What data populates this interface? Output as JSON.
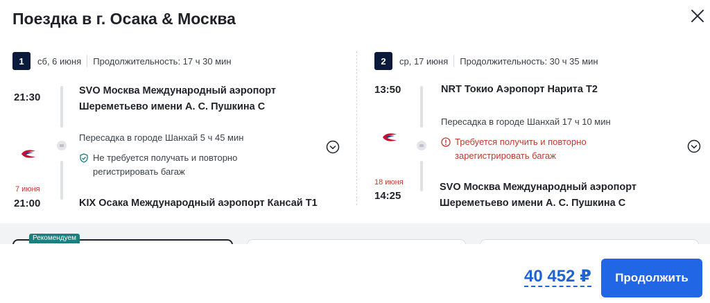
{
  "header": {
    "title": "Поездка в г. Осака & Москва"
  },
  "legs": [
    {
      "number": "1",
      "date": "сб, 6 июня",
      "duration": "Продолжительность: 17 ч 30 мин",
      "depart_time": "21:30",
      "depart_airport": "SVO Москва Международный аэропорт Шереметьево имени А. С. Пушкина C",
      "transfer": "Пересадка в городе Шанхай   5 ч 45 мин",
      "baggage_note": "Не требуется получать и повторно регистрировать багаж",
      "baggage_status": "ok",
      "arrive_date": "7 июня",
      "arrive_time": "21:00",
      "arrive_airport": "KIX Осака Международный аэропорт Кансай T1"
    },
    {
      "number": "2",
      "date": "ср, 17 июня",
      "duration": "Продолжительность: 30 ч 35 мин",
      "depart_time": "13:50",
      "depart_airport": "NRT Токио Аэропорт Нарита T2",
      "transfer": "Пересадка в городе Шанхай   17 ч 10 мин",
      "baggage_note": "Требуется получить и повторно зарегистрировать багаж",
      "baggage_status": "warn",
      "arrive_date": "18 июня",
      "arrive_time": "14:25",
      "arrive_airport": "SVO Москва Международный аэропорт Шереметьево имени А. С. Пушкина C"
    }
  ],
  "fare_badge": "Рекомендуем",
  "footer": {
    "price": "40 452 ₽",
    "continue_label": "Продолжить"
  },
  "colors": {
    "accent": "#2166e4",
    "warning": "#c0392b",
    "ok": "#1e7d7d",
    "dark": "#0b1a3a"
  },
  "icons": {
    "close": "close-icon",
    "airline": "china-eastern-logo-icon",
    "shield": "shield-check-icon",
    "warning": "warning-circle-icon",
    "expand": "chevron-down-circle-icon"
  }
}
